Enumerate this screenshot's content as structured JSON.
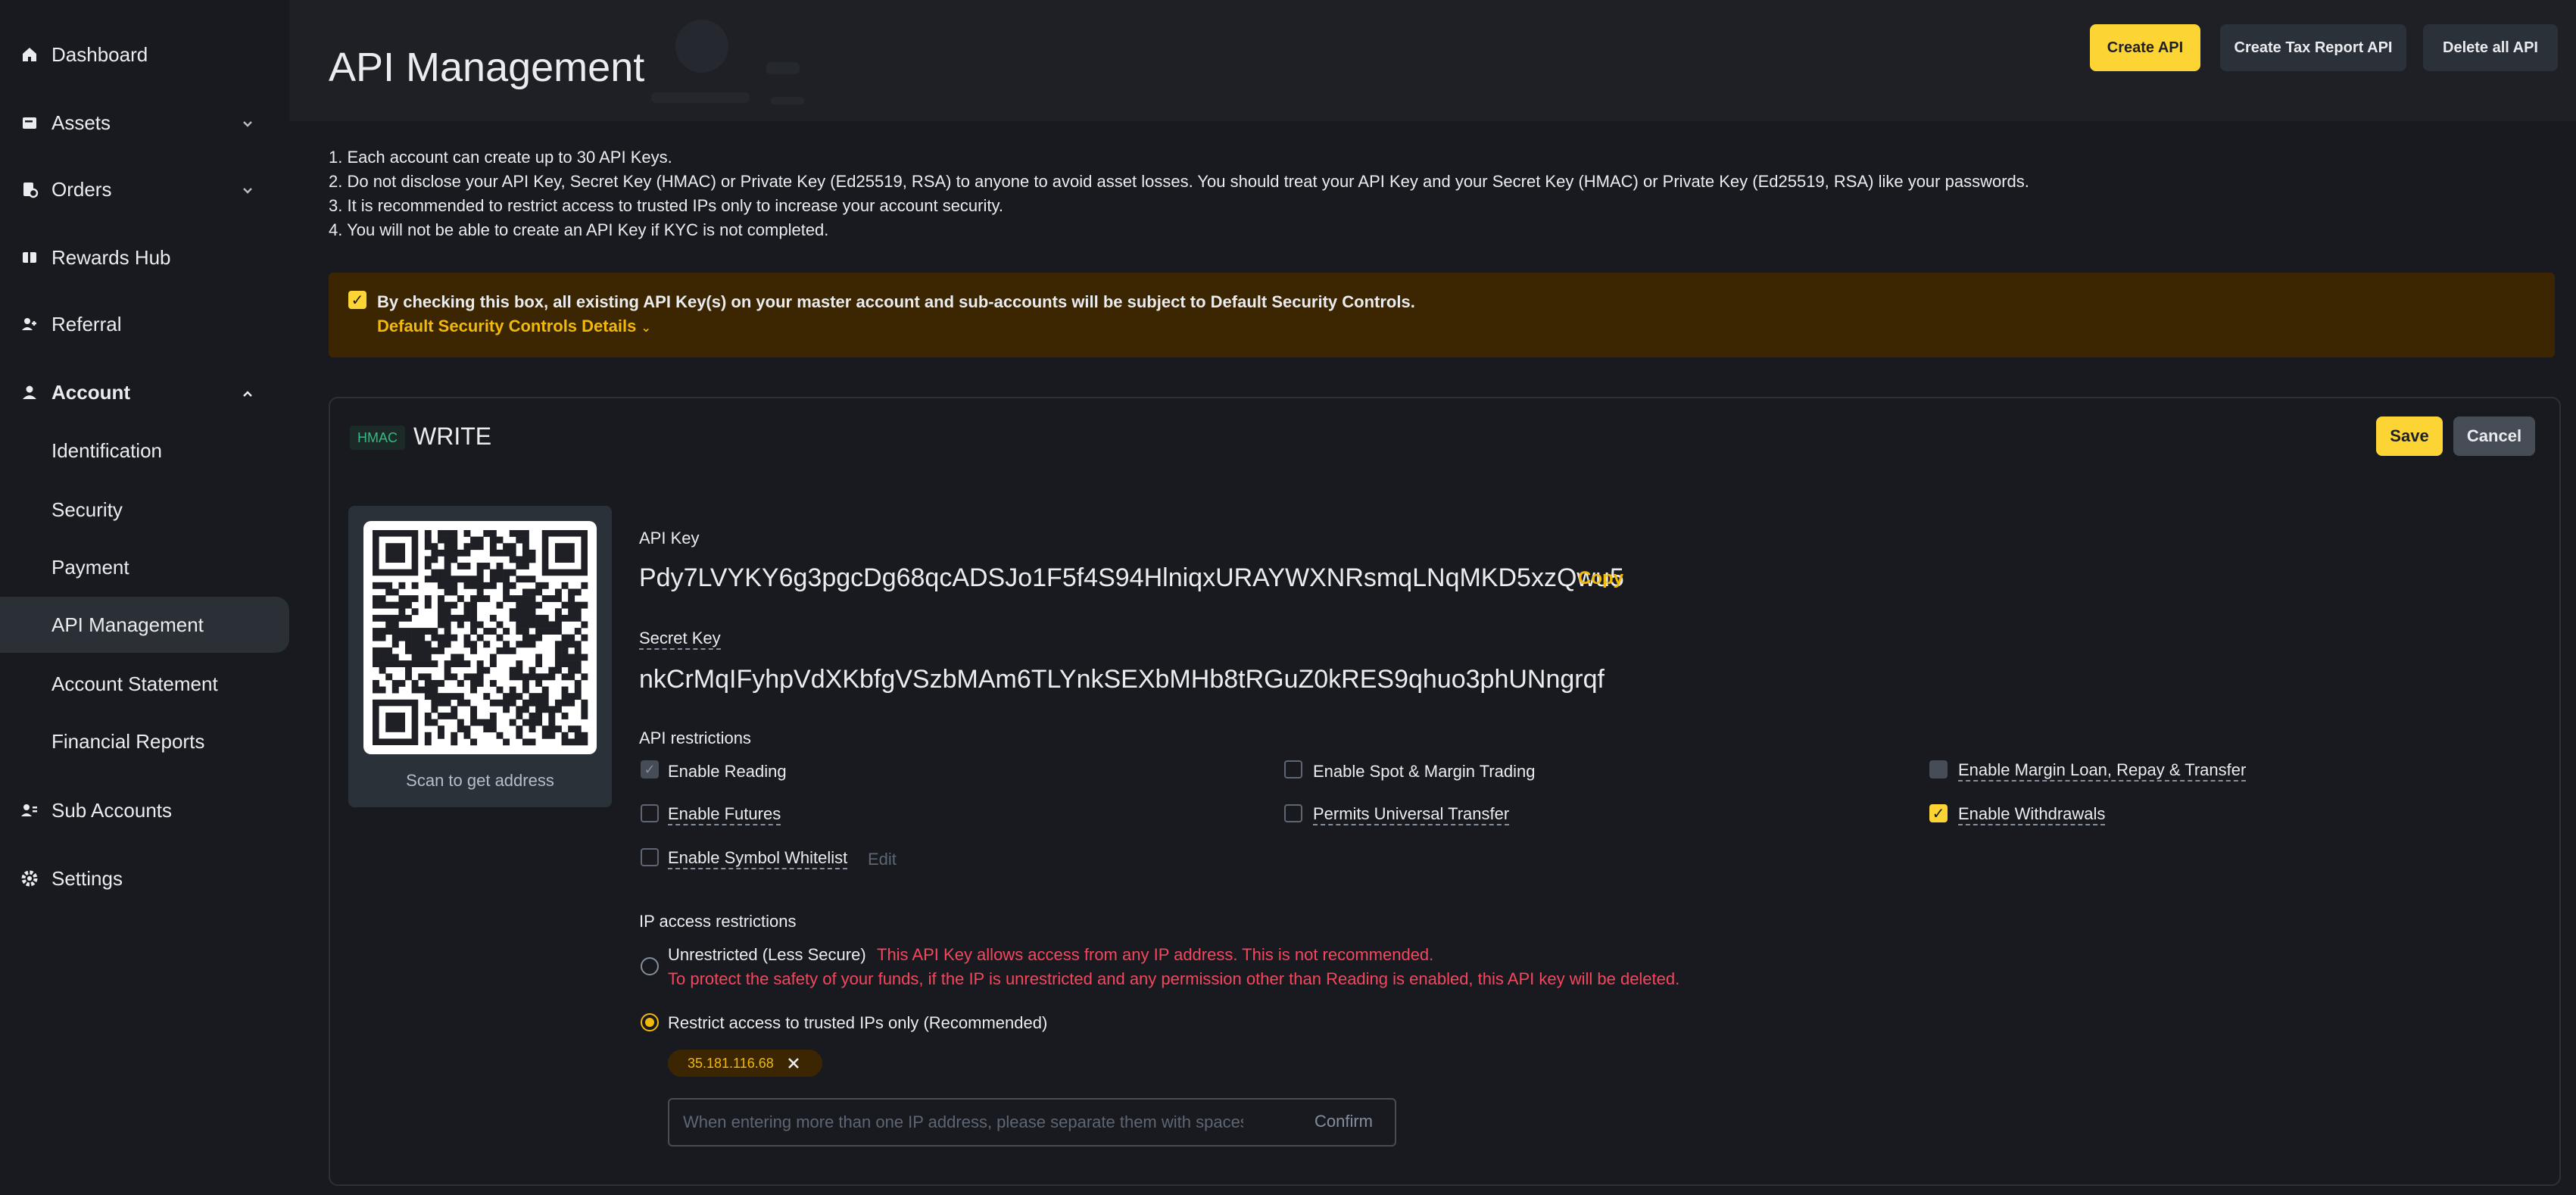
{
  "sidebar": {
    "items": [
      {
        "label": "Dashboard",
        "icon": "home-icon"
      },
      {
        "label": "Assets",
        "icon": "wallet-icon"
      },
      {
        "label": "Orders",
        "icon": "orders-icon"
      },
      {
        "label": "Rewards Hub",
        "icon": "rewards-icon"
      },
      {
        "label": "Referral",
        "icon": "referral-icon"
      },
      {
        "label": "Account",
        "icon": "user-icon"
      },
      {
        "label": "Sub Accounts",
        "icon": "sub-accounts-icon"
      },
      {
        "label": "Settings",
        "icon": "gear-icon"
      }
    ],
    "account_sub": [
      "Identification",
      "Security",
      "Payment",
      "API Management",
      "Account Statement",
      "Financial Reports"
    ]
  },
  "header": {
    "title": "API Management",
    "create_api": "Create API",
    "create_tax_api": "Create Tax Report API",
    "delete_all": "Delete all API"
  },
  "notes": [
    "1. Each account can create up to 30 API Keys.",
    "2. Do not disclose your API Key, Secret Key (HMAC) or Private Key (Ed25519, RSA) to anyone to avoid asset losses. You should treat your API Key and your Secret Key (HMAC) or Private Key (Ed25519, RSA) like your passwords.",
    "3. It is recommended to restrict access to trusted IPs only to increase your account security.",
    "4. You will not be able to create an API Key if KYC is not completed."
  ],
  "warning": {
    "text": "By checking this box, all existing API Key(s) on your master account and sub-accounts will be subject to Default Security Controls.",
    "link": "Default Security Controls Details"
  },
  "card": {
    "badge": "HMAC",
    "name": "WRITE",
    "save": "Save",
    "cancel": "Cancel",
    "qr_caption": "Scan to get address",
    "api_key_label": "API Key",
    "api_key": "Pdy7LVYKY6g3pgcDg68qcADSJo1F5f4S94HlniqxURAYWXNRsmqLNqMKD5xzQwu5",
    "copy": "Copy",
    "secret_label": "Secret Key",
    "secret": "nkCrMqIFyhpVdXKbfgVSzbMAm6TLYnkSEXbMHb8tRGuZ0kRES9qhuo3phUNngrqf",
    "restrictions_label": "API restrictions",
    "restrictions": {
      "reading": {
        "label": "Enable Reading",
        "checked": true
      },
      "spot_margin": {
        "label": "Enable Spot & Margin Trading",
        "checked": false
      },
      "margin_loan": {
        "label": "Enable Margin Loan, Repay & Transfer",
        "checked": false
      },
      "futures": {
        "label": "Enable Futures",
        "checked": false
      },
      "universal": {
        "label": "Permits Universal Transfer",
        "checked": false
      },
      "withdrawals": {
        "label": "Enable Withdrawals",
        "checked": true
      },
      "symbol_whitelist": {
        "label": "Enable Symbol Whitelist",
        "checked": false
      }
    },
    "edit": "Edit",
    "ip_label": "IP access restrictions",
    "unrestricted": "Unrestricted (Less Secure)",
    "unrestricted_warn1": "This API Key allows access from any IP address. This is not recommended.",
    "unrestricted_warn2": "To protect the safety of your funds, if the IP is unrestricted and any permission other than Reading is enabled, this API key will be deleted.",
    "restricted": "Restrict access to trusted IPs only (Recommended)",
    "ip": "35.181.116.68",
    "ip_placeholder": "When entering more than one IP address, please separate them with spaces.",
    "confirm": "Confirm"
  },
  "colors": {
    "accent": "#fcd535",
    "bg": "#181a20",
    "danger": "#f6465d",
    "success": "#2ebd85"
  }
}
